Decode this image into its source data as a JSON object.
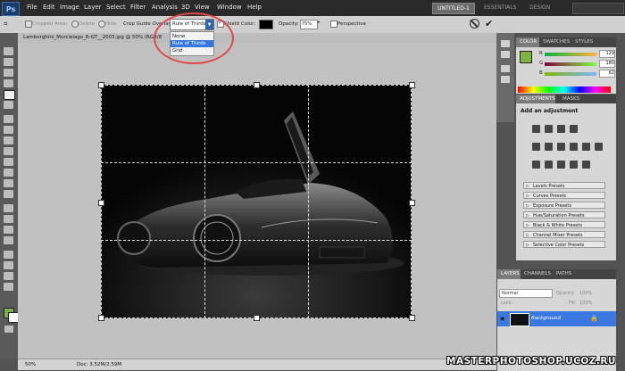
{
  "app": {
    "logo": "Ps"
  },
  "menu": [
    "File",
    "Edit",
    "Image",
    "Layer",
    "Select",
    "Filter",
    "Analysis",
    "3D",
    "View",
    "Window",
    "Help"
  ],
  "workspaces": {
    "active": "UNTITLED-1",
    "others": [
      "ESSENTIALS",
      "DESIGN"
    ]
  },
  "options": {
    "cropped_area": "Cropped Area:",
    "delete": "Delete",
    "hide": "Hide",
    "crop_guide_label": "Crop Guide Overlay:",
    "crop_guide_value": "Rule of Thirds",
    "shield": "Shield",
    "color": "Color:",
    "opacity_label": "Opacity:",
    "opacity_value": "75%",
    "perspective": "Perspective"
  },
  "dropdown": {
    "options": [
      "None",
      "Rule of Thirds",
      "Grid"
    ],
    "selected": "Rule of Thirds"
  },
  "document": {
    "tab_title": "Lamborghini_Murcielago_R-GT__2003.jpg @ 50% (RGB/8",
    "close": "×"
  },
  "status": {
    "zoom": "50%",
    "doc": "Doc: 3.52M/2.59M"
  },
  "color_panel": {
    "tabs": [
      "COLOR",
      "SWATCHES",
      "STYLES"
    ],
    "channels": [
      {
        "label": "R",
        "value": "129"
      },
      {
        "label": "G",
        "value": "180"
      },
      {
        "label": "B",
        "value": "62"
      }
    ],
    "fg_color": "#81b43e"
  },
  "adjustments_panel": {
    "tabs": [
      "ADJUSTMENTS",
      "MASKS"
    ],
    "title": "Add an adjustment",
    "presets": [
      "Levels Presets",
      "Curves Presets",
      "Exposure Presets",
      "Hue/Saturation Presets",
      "Black & White Presets",
      "Channel Mixer Presets",
      "Selective Color Presets"
    ]
  },
  "layers_panel": {
    "tabs": [
      "LAYERS",
      "CHANNELS",
      "PATHS"
    ],
    "blend_mode": "Normal",
    "opacity_label": "Opacity:",
    "opacity_value": "100%",
    "lock_label": "Lock:",
    "fill_label": "Fill:",
    "fill_value": "100%",
    "layer_name": "Background"
  },
  "watermark": "MASTERPHOTOSHOP.UCOZ.RU"
}
